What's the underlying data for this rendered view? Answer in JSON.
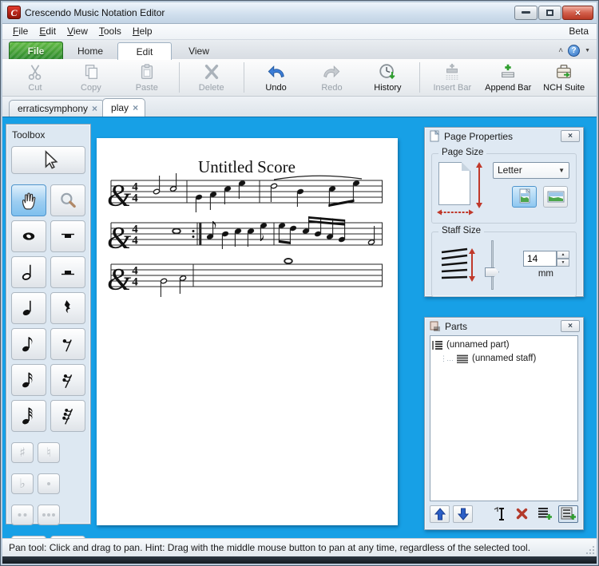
{
  "window": {
    "title": "Crescendo Music Notation Editor",
    "beta_label": "Beta"
  },
  "menu": {
    "items": [
      "File",
      "Edit",
      "View",
      "Tools",
      "Help"
    ]
  },
  "ribbon": {
    "tabs": [
      {
        "label": "File"
      },
      {
        "label": "Home"
      },
      {
        "label": "Edit"
      },
      {
        "label": "View"
      }
    ],
    "active_tab": "Edit",
    "right_icons": [
      "collapse-ribbon-icon",
      "help-icon",
      "dropdown-arrow-icon"
    ]
  },
  "toolbar": {
    "buttons": [
      {
        "label": "Cut",
        "icon": "cut-icon",
        "enabled": false
      },
      {
        "label": "Copy",
        "icon": "copy-icon",
        "enabled": false
      },
      {
        "label": "Paste",
        "icon": "paste-icon",
        "enabled": false
      },
      {
        "label": "Delete",
        "icon": "delete-icon",
        "enabled": false
      },
      {
        "label": "Undo",
        "icon": "undo-icon",
        "enabled": true
      },
      {
        "label": "Redo",
        "icon": "redo-icon",
        "enabled": false
      },
      {
        "label": "History",
        "icon": "history-icon",
        "enabled": true
      },
      {
        "label": "Insert Bar",
        "icon": "insert-bar-icon",
        "enabled": false
      },
      {
        "label": "Append Bar",
        "icon": "append-bar-icon",
        "enabled": true
      },
      {
        "label": "NCH Suite",
        "icon": "nch-suite-icon",
        "enabled": true
      }
    ]
  },
  "document_tabs": [
    {
      "label": "erraticsymphony",
      "active": false
    },
    {
      "label": "play",
      "active": true
    }
  ],
  "toolbox": {
    "title": "Toolbox",
    "active_tool": "pan",
    "tools": [
      {
        "icon": "select-arrow-icon",
        "enabled": true
      },
      {
        "icon": "pan-hand-icon",
        "enabled": true,
        "active": true
      },
      {
        "icon": "zoom-magnifier-icon",
        "enabled": true
      },
      {
        "icon": "whole-note-icon",
        "enabled": true
      },
      {
        "icon": "whole-rest-icon",
        "enabled": true
      },
      {
        "icon": "half-note-icon",
        "enabled": true
      },
      {
        "icon": "half-rest-icon",
        "enabled": true
      },
      {
        "icon": "quarter-note-icon",
        "enabled": true
      },
      {
        "icon": "quarter-rest-icon",
        "enabled": true
      },
      {
        "icon": "eighth-note-icon",
        "enabled": true
      },
      {
        "icon": "eighth-rest-icon",
        "enabled": true
      },
      {
        "icon": "sixteenth-note-icon",
        "enabled": true
      },
      {
        "icon": "sixteenth-rest-icon",
        "enabled": true
      },
      {
        "icon": "thirtysecond-note-icon",
        "enabled": true
      },
      {
        "icon": "thirtysecond-rest-icon",
        "enabled": true
      },
      {
        "icon": "sharp-icon",
        "enabled": false
      },
      {
        "icon": "natural-icon",
        "enabled": false
      },
      {
        "icon": "flat-icon",
        "enabled": false
      },
      {
        "icon": "dot-icon",
        "enabled": false
      },
      {
        "icon": "double-dot-icon",
        "enabled": false
      },
      {
        "icon": "triple-dot-icon",
        "enabled": false
      },
      {
        "icon": "tie-icon",
        "enabled": true
      },
      {
        "icon": "tuplet-icon",
        "enabled": true
      }
    ],
    "accidental_glyphs": {
      "sharp": "♯",
      "natural": "♮",
      "flat": "♭"
    }
  },
  "score": {
    "title": "Untitled Score",
    "time_signature": "4/4",
    "clef": "treble",
    "staves": [
      {
        "bars": [
          "half B4, half C5",
          "quarters G4 A4 C5 E5",
          "half D5, quarter B4, beamed eighths C5 E5 under slur"
        ]
      },
      {
        "bars": [
          "whole C5, end-repeat barline",
          "eighth A4, quarters B4 C5 C5, eighth E5",
          "beamed eighths E5 D5, beamed sixteenths C5 B4 A4 G4, half F4"
        ]
      },
      {
        "bars": [
          "half G4, half A4",
          "whole G5"
        ]
      }
    ]
  },
  "page_properties": {
    "title": "Page Properties",
    "page_size_label": "Page Size",
    "page_size_value": "Letter",
    "orientation": "portrait",
    "staff_size_label": "Staff Size",
    "staff_size_value": "14",
    "staff_size_unit": "mm"
  },
  "parts": {
    "title": "Parts",
    "items": [
      {
        "label": "(unnamed part)"
      },
      {
        "label": "(unnamed staff)"
      }
    ],
    "buttons": [
      "move-up-icon",
      "move-down-icon",
      "rename-icon",
      "delete-part-icon",
      "add-part-icon",
      "add-staff-icon"
    ]
  },
  "status_bar": {
    "text": "Pan tool: Click and drag to pan. Hint: Drag with the middle mouse button to pan at any time, regardless of the selected tool."
  },
  "glyphs": {
    "tab_close": "×",
    "panel_close": "×",
    "dropdown_arrow": "▼",
    "ribbon_collapse": "˄",
    "help": "?",
    "spin_up": "▲",
    "spin_down": "▼"
  },
  "colors": {
    "canvas_blue": "#17a0e6",
    "accent_green": "#2f9e2f",
    "active_tool_blue": "#7fc0ee",
    "dimension_red": "#c0392b"
  }
}
